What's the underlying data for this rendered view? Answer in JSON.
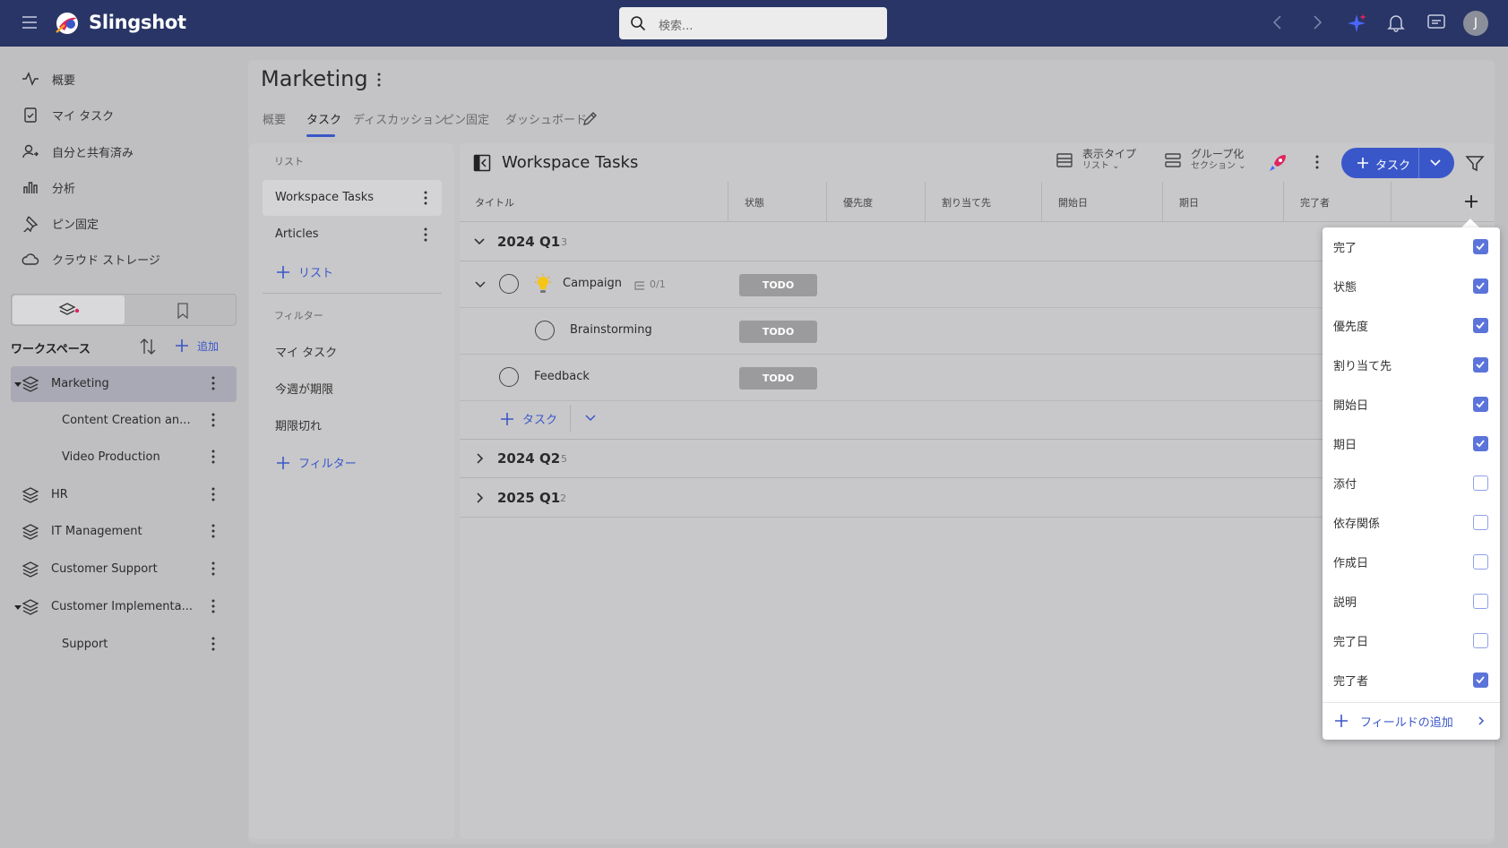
{
  "topbar": {
    "brand": "Slingshot",
    "search_placeholder": "検索...",
    "avatar_initial": "J"
  },
  "nav": [
    {
      "label": "概要",
      "icon": "activity-icon"
    },
    {
      "label": "マイ タスク",
      "icon": "clipboard-check-icon"
    },
    {
      "label": "自分と共有済み",
      "icon": "user-share-icon"
    },
    {
      "label": "分析",
      "icon": "bar-chart-icon"
    },
    {
      "label": "ピン固定",
      "icon": "pin-icon"
    },
    {
      "label": "クラウド ストレージ",
      "icon": "cloud-icon"
    }
  ],
  "workspace": {
    "header": "ワークスペース",
    "add_label": "追加",
    "items": [
      {
        "label": "Marketing",
        "level": 0,
        "selected": true
      },
      {
        "label": "Content Creation an...",
        "level": 1
      },
      {
        "label": "Video Production",
        "level": 1
      },
      {
        "label": "HR",
        "level": 0
      },
      {
        "label": "IT Management",
        "level": 0
      },
      {
        "label": "Customer Support",
        "level": 0
      },
      {
        "label": "Customer Implementa...",
        "level": 0
      },
      {
        "label": "Support",
        "level": 1
      }
    ]
  },
  "page": {
    "title": "Marketing",
    "tabs": [
      "概要",
      "タスク",
      "ディスカッション",
      "ピン固定",
      "ダッシュボード"
    ],
    "active_tab": "タスク"
  },
  "lists": {
    "section_label": "リスト",
    "items": [
      "Workspace Tasks",
      "Articles"
    ],
    "add_list_label": "リスト",
    "filter_section_label": "フィルター",
    "filters": [
      "マイ タスク",
      "今週が期限",
      "期限切れ"
    ],
    "add_filter_label": "フィルター"
  },
  "table": {
    "title": "Workspace Tasks",
    "view_type_label": "表示タイプ",
    "view_type_value": "リスト",
    "group_label": "グループ化",
    "group_value": "セクション",
    "add_task_label": "タスク",
    "columns": [
      "タイトル",
      "状態",
      "優先度",
      "割り当て先",
      "開始日",
      "期日",
      "完了者"
    ],
    "groups": [
      {
        "label": "2024 Q1",
        "count": "3",
        "expanded": true
      },
      {
        "label": "2024 Q2",
        "count": "5",
        "expanded": false
      },
      {
        "label": "2025 Q1",
        "count": "2",
        "expanded": false
      }
    ],
    "tasks": [
      {
        "title": "Campaign",
        "status": "TODO",
        "subtasks": "0/1"
      },
      {
        "title": "Brainstorming",
        "status": "TODO"
      },
      {
        "title": "Feedback",
        "status": "TODO"
      }
    ],
    "add_task_row_label": "タスク"
  },
  "field_menu": {
    "items": [
      {
        "label": "完了",
        "checked": true
      },
      {
        "label": "状態",
        "checked": true
      },
      {
        "label": "優先度",
        "checked": true
      },
      {
        "label": "割り当て先",
        "checked": true
      },
      {
        "label": "開始日",
        "checked": true
      },
      {
        "label": "期日",
        "checked": true
      },
      {
        "label": "添付",
        "checked": false
      },
      {
        "label": "依存関係",
        "checked": false
      },
      {
        "label": "作成日",
        "checked": false
      },
      {
        "label": "説明",
        "checked": false
      },
      {
        "label": "完了日",
        "checked": false
      },
      {
        "label": "完了者",
        "checked": true
      }
    ],
    "add_field_label": "フィールドの追加"
  },
  "colors": {
    "topbar": "#283566",
    "accent": "#3a57c9",
    "checkbox": "#5b74da"
  }
}
